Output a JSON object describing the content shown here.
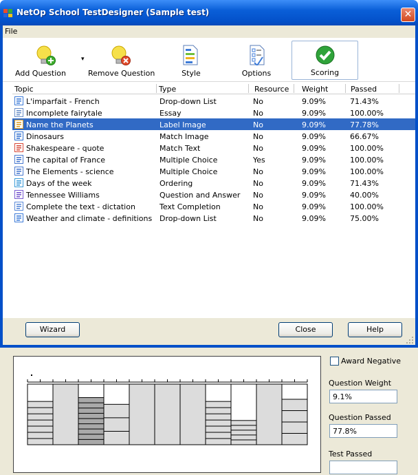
{
  "window": {
    "title": "NetOp School TestDesigner (Sample test)",
    "close_glyph": "✕"
  },
  "menu": {
    "file": "File"
  },
  "toolbar": {
    "add_question": "Add Question",
    "add_dropdown_glyph": "▾",
    "remove_question": "Remove Question",
    "style": "Style",
    "options": "Options",
    "scoring": "Scoring"
  },
  "columns": {
    "topic": "Topic",
    "type": "Type",
    "resource": "Resource",
    "weight": "Weight",
    "passed": "Passed"
  },
  "rows": [
    {
      "topic": "L'imparfait - French",
      "type": "Drop-down List",
      "resource": "No",
      "weight": "9.09%",
      "passed": "71.43%",
      "icon": "dropdown-list-icon"
    },
    {
      "topic": "Incomplete fairytale",
      "type": "Essay",
      "resource": "No",
      "weight": "9.09%",
      "passed": "100.00%",
      "icon": "essay-icon"
    },
    {
      "topic": "Name the Planets",
      "type": "Label Image",
      "resource": "No",
      "weight": "9.09%",
      "passed": "77.78%",
      "icon": "label-image-icon",
      "selected": true
    },
    {
      "topic": "Dinosaurs",
      "type": "Match Image",
      "resource": "No",
      "weight": "9.09%",
      "passed": "66.67%",
      "icon": "match-image-icon"
    },
    {
      "topic": "Shakespeare - quote",
      "type": "Match Text",
      "resource": "No",
      "weight": "9.09%",
      "passed": "100.00%",
      "icon": "match-text-icon"
    },
    {
      "topic": "The capital of France",
      "type": "Multiple Choice",
      "resource": "Yes",
      "weight": "9.09%",
      "passed": "100.00%",
      "icon": "multiple-choice-icon"
    },
    {
      "topic": "The Elements - science",
      "type": "Multiple Choice",
      "resource": "No",
      "weight": "9.09%",
      "passed": "100.00%",
      "icon": "multiple-choice-icon"
    },
    {
      "topic": "Days of the week",
      "type": "Ordering",
      "resource": "No",
      "weight": "9.09%",
      "passed": "71.43%",
      "icon": "ordering-icon"
    },
    {
      "topic": "Tennessee Williams",
      "type": "Question and Answer",
      "resource": "No",
      "weight": "9.09%",
      "passed": "40.00%",
      "icon": "question-answer-icon"
    },
    {
      "topic": "Complete the text - dictation",
      "type": "Text Completion",
      "resource": "No",
      "weight": "9.09%",
      "passed": "100.00%",
      "icon": "text-completion-icon"
    },
    {
      "topic": "Weather and climate - definitions",
      "type": "Drop-down List",
      "resource": "No",
      "weight": "9.09%",
      "passed": "75.00%",
      "icon": "dropdown-list-icon"
    }
  ],
  "buttons": {
    "wizard": "Wizard",
    "close": "Close",
    "help": "Help"
  },
  "scoring_panel": {
    "award_negative": "Award Negative",
    "award_negative_checked": false,
    "question_weight_label": "Question Weight",
    "question_weight_value": "9.1%",
    "question_passed_label": "Question Passed",
    "question_passed_value": "77.8%",
    "test_passed_label": "Test Passed",
    "test_passed_value": ""
  },
  "colors": {
    "selection": "#316ac5",
    "titlebar": "#0350c9",
    "column_fill": "#dcdcdc",
    "selected_column_fill": "#a9a9a9"
  },
  "chart_data": {
    "type": "bar",
    "stacked": true,
    "categories": [
      "L'imparfait - French",
      "Incomplete fairytale",
      "Name the Planets",
      "Dinosaurs",
      "Shakespeare - quote",
      "The capital of France",
      "The Elements - science",
      "Days of the week",
      "Tennessee Williams",
      "Complete the text - dictation",
      "Weather and climate - definitions"
    ],
    "passed_percent": [
      71.43,
      100,
      77.78,
      66.67,
      100,
      100,
      100,
      71.43,
      40,
      100,
      75
    ],
    "segments": [
      7,
      1,
      9,
      3,
      1,
      1,
      1,
      7,
      5,
      1,
      4
    ],
    "selected_index": 2,
    "ylim": [
      0,
      100
    ],
    "grid": false
  }
}
